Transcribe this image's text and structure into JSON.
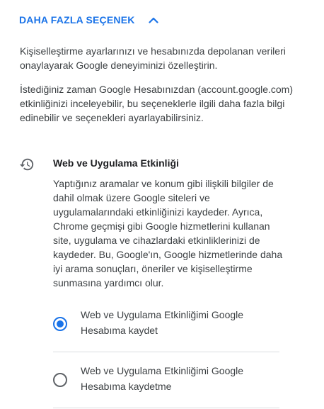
{
  "more_options": {
    "label": "DAHA FAZLA SEÇENEK",
    "icon": "chevron-up-icon",
    "accent": "#1a73e8"
  },
  "intro": {
    "p1": "Kişiselleştirme ayarlarınızı ve hesabınızda depolanan verileri onaylayarak Google deneyiminizi özelleştirin.",
    "p2": "İstediğiniz zaman Google Hesabınızdan (account.google.com) etkinliğinizi inceleyebilir, bu seçeneklerle ilgili daha fazla bilgi edinebilir ve seçenekleri ayarlayabilirsiniz."
  },
  "web_activity": {
    "icon": "history-icon",
    "title": "Web ve Uygulama Etkinliği",
    "description": "Yaptığınız aramalar ve konum gibi ilişkili bilgiler de dahil olmak üzere Google siteleri ve uygulamalarındaki etkinliğinizi kaydeder. Ayrıca, Chrome geçmişi gibi Google hizmetlerini kullanan site, uygulama ve cihazlardaki etkinliklerinizi de kaydeder. Bu, Google'ın, Google hizmetlerinde daha iyi arama sonuçları, öneriler ve kişiselleştirme sunmasına yardımcı olur.",
    "options": [
      {
        "label": "Web ve Uygulama Etkinliğimi Google Hesabıma kaydet",
        "selected": true
      },
      {
        "label": "Web ve Uygulama Etkinliğimi Google Hesabıma kaydetme",
        "selected": false
      }
    ]
  }
}
